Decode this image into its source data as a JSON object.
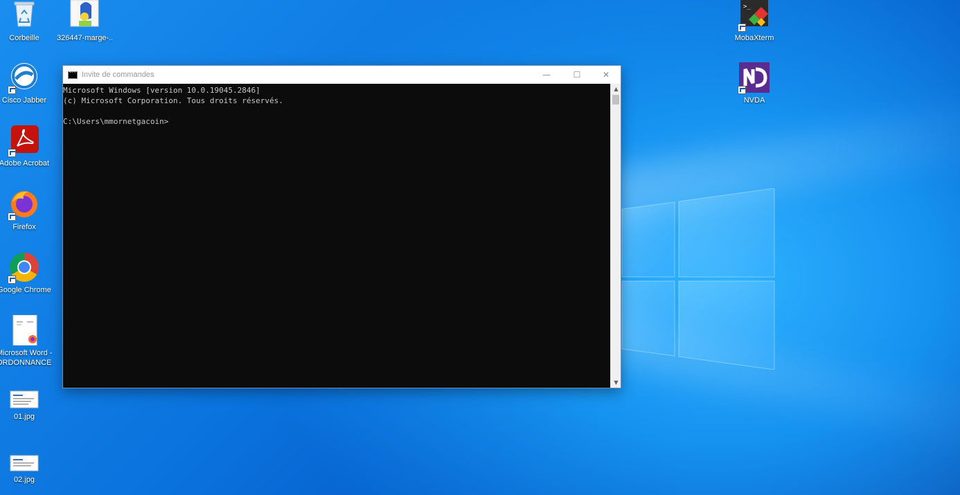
{
  "desktop": {
    "icons_left": [
      {
        "label": "Corbeille",
        "icon": "recycle-bin-icon"
      },
      {
        "label": "326447-marge-...",
        "icon": "image-file-icon"
      },
      {
        "label": "Cisco Jabber",
        "icon": "cisco-jabber-icon"
      },
      {
        "label": "Adobe Acrobat",
        "icon": "adobe-acrobat-icon"
      },
      {
        "label": "Firefox",
        "icon": "firefox-icon"
      },
      {
        "label": "Google Chrome",
        "icon": "chrome-icon"
      },
      {
        "label": "Microsoft Word - ORDONNANCE...",
        "label_line1": "Microsoft Word -",
        "label_line2": "ORDONNANCE...",
        "icon": "word-document-icon"
      },
      {
        "label": "01.jpg",
        "icon": "jpg-file-icon"
      },
      {
        "label": "02.jpg",
        "icon": "jpg-file-icon"
      }
    ],
    "icons_right": [
      {
        "label": "MobaXterm",
        "icon": "mobaxterm-icon"
      },
      {
        "label": "NVDA",
        "icon": "nvda-icon"
      }
    ]
  },
  "cmd_window": {
    "title": "Invite de commandes",
    "minimize": "—",
    "maximize": "☐",
    "close": "✕",
    "lines": [
      "Microsoft Windows [version 10.0.19045.2846]",
      "(c) Microsoft Corporation. Tous droits réservés.",
      "",
      "C:\\Users\\mmornetgacoin>"
    ],
    "scroll_up": "▲",
    "scroll_down": "▼"
  },
  "colors": {
    "desktop_blue": "#0a72dc",
    "console_bg": "#0c0c0c",
    "console_text": "#c7c7c7"
  }
}
